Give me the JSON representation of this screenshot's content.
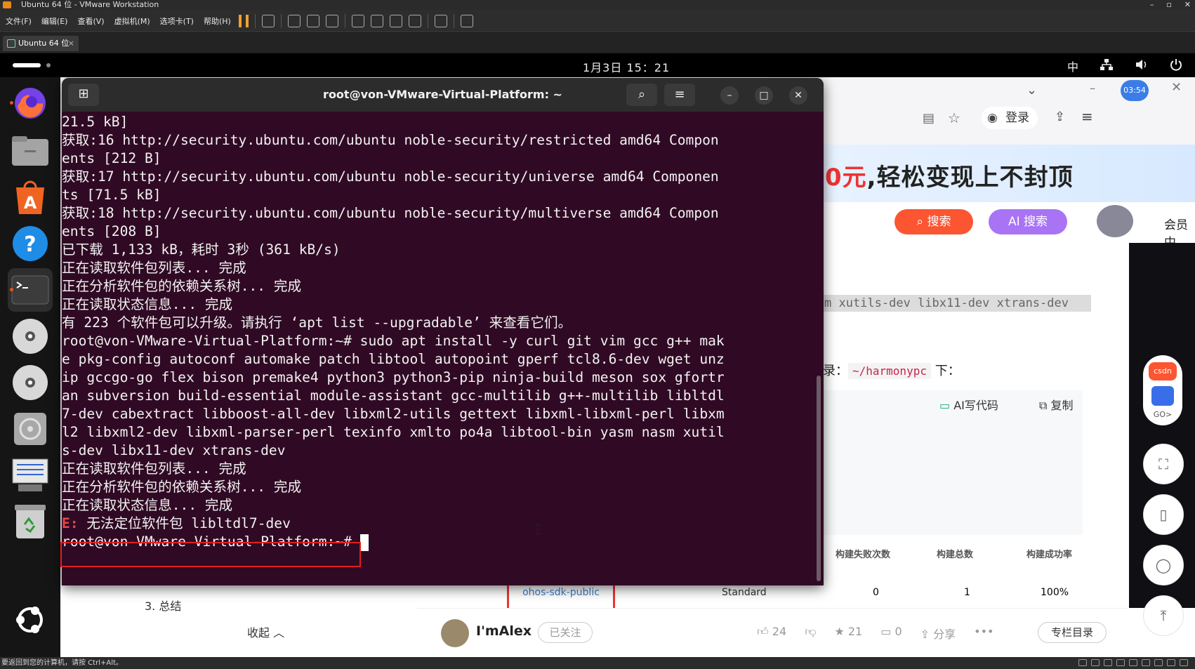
{
  "vmware": {
    "window_title": "Ubuntu 64 位 - VMware Workstation",
    "menu": [
      "文件(F)",
      "编辑(E)",
      "查看(V)",
      "虚拟机(M)",
      "选项卡(T)",
      "帮助(H)"
    ],
    "tab_label": "Ubuntu 64 位",
    "status_text": "要返回到您的计算机，请按 Ctrl+Alt。"
  },
  "ubuntu_panel": {
    "clock": "1月3日 15：21",
    "input_method": "中"
  },
  "terminal": {
    "title": "root@von-VMware-Virtual-Platform: ~",
    "lines": [
      "21.5 kB]",
      "获取:16 http://security.ubuntu.com/ubuntu noble-security/restricted amd64 Compon",
      "ents [212 B]",
      "获取:17 http://security.ubuntu.com/ubuntu noble-security/universe amd64 Componen",
      "ts [71.5 kB]",
      "获取:18 http://security.ubuntu.com/ubuntu noble-security/multiverse amd64 Compon",
      "ents [208 B]",
      "已下载 1,133 kB，耗时 3秒 (361 kB/s)",
      "正在读取软件包列表... 完成",
      "正在分析软件包的依赖关系树... 完成",
      "正在读取状态信息... 完成",
      "有 223 个软件包可以升级。请执行 ‘apt list --upgradable’ 来查看它们。",
      "root@von-VMware-Virtual-Platform:~# sudo apt install -y curl git vim gcc g++ mak",
      "e pkg-config autoconf automake patch libtool autopoint gperf tcl8.6-dev wget unz",
      "ip gccgo-go flex bison premake4 python3 python3-pip ninja-build meson sox gfortr",
      "an subversion build-essential module-assistant gcc-multilib g++-multilib libltdl",
      "7-dev cabextract libboost-all-dev libxml2-utils gettext libxml-libxml-perl libxm",
      "l2 libxml2-dev libxml-parser-perl texinfo xmlto po4a libtool-bin yasm nasm xutil",
      "s-dev libx11-dev xtrans-dev",
      "正在读取软件包列表... 完成",
      "正在分析软件包的依赖关系树... 完成",
      "正在读取状态信息... 完成"
    ],
    "error_prefix": "E:",
    "error_message": " 无法定位软件包 libltdl7-dev",
    "prompt": "root@von-VMware-Virtual-Platform:~# "
  },
  "browser": {
    "timer_badge": "03:54",
    "login_label": "登录",
    "banner_red": "0元",
    "banner_text": ",轻松变现上不封顶",
    "search_btn": "搜索",
    "ai_search_btn": "AI 搜索",
    "member_text": "会员中",
    "code_highlight": "m xutils-dev libx11-dev xtrans-dev",
    "dir_prefix": "录：",
    "dir_code": "~/harmonypc",
    "dir_suffix": " 下：",
    "ai_code": "AI写代码",
    "copy": "复制",
    "table_headers": [
      "构建失败次数",
      "构建总数",
      "构建成功率"
    ],
    "table_row": {
      "repo": "ohos-sdk-public",
      "type": "Standard",
      "failures": "0",
      "total": "1",
      "rate": "100%"
    },
    "toc_item": "3. 总结",
    "collapse": "收起 ︿",
    "widget_label": "GO>",
    "widget_brand": "csdn",
    "author": {
      "name": "I'mAlex",
      "follow": "已关注",
      "likes": "24",
      "stars": "21",
      "comments": "0",
      "share": "分享",
      "more": "•••",
      "column_toc": "专栏目录"
    }
  }
}
